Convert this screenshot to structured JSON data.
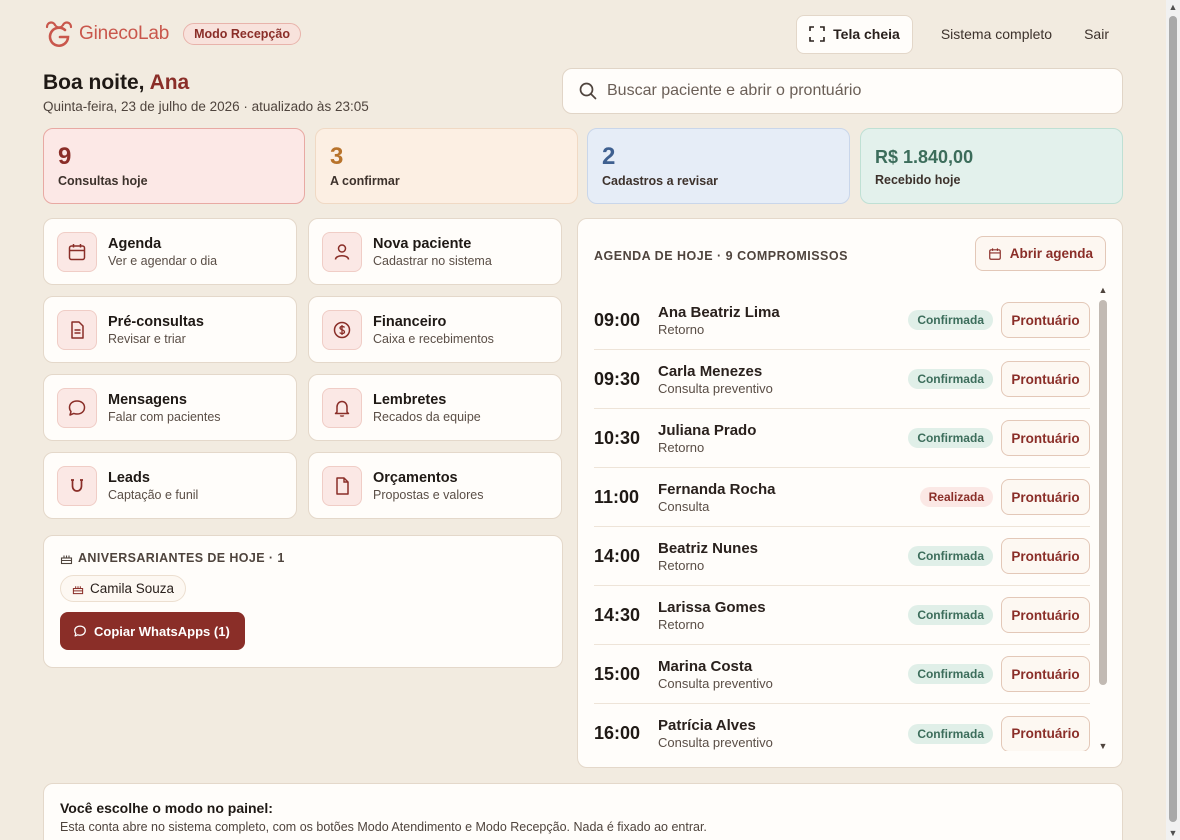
{
  "brand": {
    "name": "GinecoLab",
    "mode_badge": "Modo Recepção",
    "accent": "#c9574c"
  },
  "topbar": {
    "fullscreen_label": "Tela cheia",
    "full_system_label": "Sistema completo",
    "logout_label": "Sair"
  },
  "greeting": {
    "prefix": "Boa noite, ",
    "name": "Ana",
    "date_line": "Quinta-feira, 23 de julho de 2026 · atualizado às 23:05"
  },
  "search": {
    "placeholder": "Buscar paciente e abrir o prontuário"
  },
  "stats": [
    {
      "value": "9",
      "label": "Consultas hoje"
    },
    {
      "value": "3",
      "label": "A confirmar"
    },
    {
      "value": "2",
      "label": "Cadastros a revisar"
    },
    {
      "value": "R$ 1.840,00",
      "label": "Recebido hoje"
    }
  ],
  "quick_actions": [
    {
      "title": "Agenda",
      "subtitle": "Ver e agendar o dia",
      "icon": "calendar-icon"
    },
    {
      "title": "Nova paciente",
      "subtitle": "Cadastrar no sistema",
      "icon": "user-icon"
    },
    {
      "title": "Pré-consultas",
      "subtitle": "Revisar e triar",
      "icon": "document-icon"
    },
    {
      "title": "Financeiro",
      "subtitle": "Caixa e recebimentos",
      "icon": "dollar-icon"
    },
    {
      "title": "Mensagens",
      "subtitle": "Falar com pacientes",
      "icon": "chat-icon"
    },
    {
      "title": "Lembretes",
      "subtitle": "Recados da equipe",
      "icon": "bell-icon"
    },
    {
      "title": "Leads",
      "subtitle": "Captação e funil",
      "icon": "magnet-icon"
    },
    {
      "title": "Orçamentos",
      "subtitle": "Propostas e valores",
      "icon": "file-icon"
    }
  ],
  "birthdays": {
    "title": "ANIVERSARIANTES DE HOJE · 1",
    "people": [
      "Camila Souza"
    ],
    "whatsapp_button": "Copiar WhatsApps (1)"
  },
  "agenda": {
    "title": "AGENDA DE HOJE · 9 COMPROMISSOS",
    "open_button": "Abrir agenda",
    "record_button": "Prontuário",
    "items": [
      {
        "time": "09:00",
        "name": "Ana Beatriz Lima",
        "type": "Retorno",
        "status": "Confirmada"
      },
      {
        "time": "09:30",
        "name": "Carla Menezes",
        "type": "Consulta preventivo",
        "status": "Confirmada"
      },
      {
        "time": "10:30",
        "name": "Juliana Prado",
        "type": "Retorno",
        "status": "Confirmada"
      },
      {
        "time": "11:00",
        "name": "Fernanda Rocha",
        "type": "Consulta",
        "status": "Realizada"
      },
      {
        "time": "14:00",
        "name": "Beatriz Nunes",
        "type": "Retorno",
        "status": "Confirmada"
      },
      {
        "time": "14:30",
        "name": "Larissa Gomes",
        "type": "Retorno",
        "status": "Confirmada"
      },
      {
        "time": "15:00",
        "name": "Marina Costa",
        "type": "Consulta preventivo",
        "status": "Confirmada"
      },
      {
        "time": "16:00",
        "name": "Patrícia Alves",
        "type": "Consulta preventivo",
        "status": "Confirmada"
      }
    ]
  },
  "note": {
    "title": "Você escolhe o modo no painel:",
    "text": "Esta conta abre no sistema completo, com os botões Modo Atendimento e Modo Recepção. Nada é fixado ao entrar."
  }
}
